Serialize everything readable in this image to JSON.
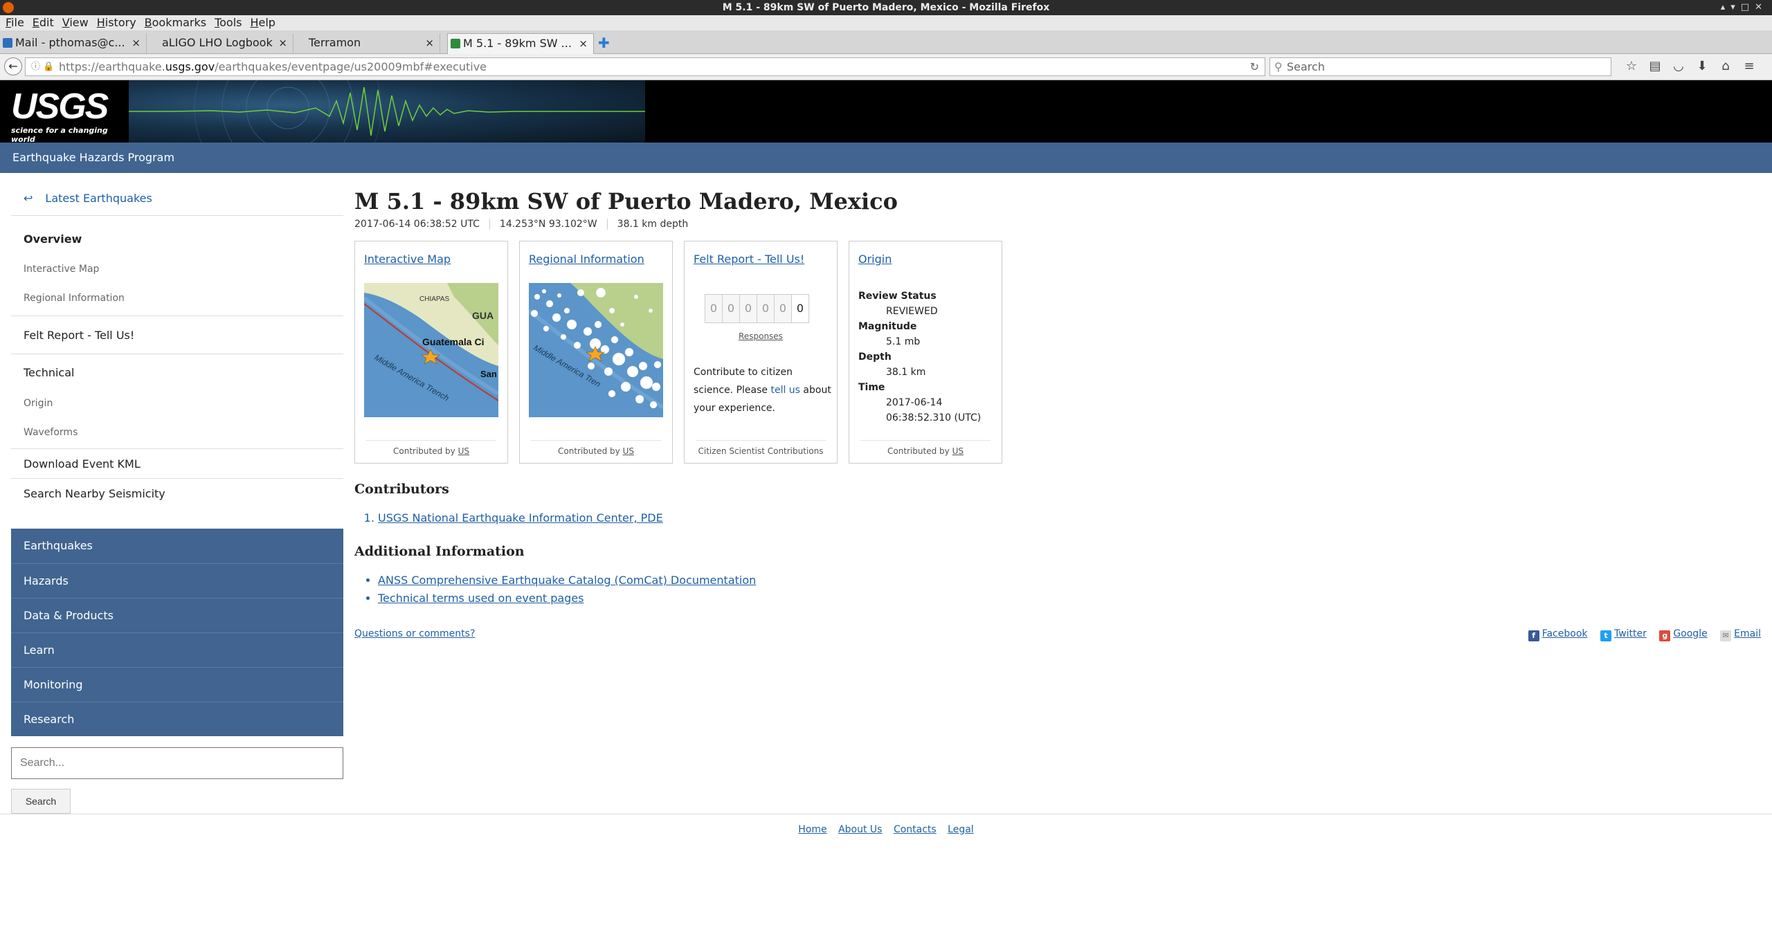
{
  "window": {
    "title": "M 5.1 - 89km SW of Puerto Madero, Mexico - Mozilla Firefox"
  },
  "menu": [
    "File",
    "Edit",
    "View",
    "History",
    "Bookmarks",
    "Tools",
    "Help"
  ],
  "tabs": [
    {
      "label": "Mail - pthomas@c...",
      "icon_color": "#2a6fbd"
    },
    {
      "label": "aLIGO LHO Logbook",
      "icon_color": ""
    },
    {
      "label": "Terramon",
      "icon_color": ""
    },
    {
      "label": "M 5.1 - 89km SW ...",
      "icon_color": "#2e8b3a"
    }
  ],
  "url": {
    "prefix": "https://earthquake.",
    "host": "usgs.gov",
    "path": "/earthquakes/eventpage/us20009mbf#executive"
  },
  "search_placeholder": "Search",
  "site": {
    "logo_text": "USGS",
    "logo_tagline": "science for a changing world",
    "program": "Earthquake Hazards Program"
  },
  "sidebar": {
    "latest": "Latest Earthquakes",
    "overview": "Overview",
    "interactive_map": "Interactive Map",
    "regional_info": "Regional Information",
    "felt_report": "Felt Report - Tell Us!",
    "technical": "Technical",
    "origin": "Origin",
    "waveforms": "Waveforms",
    "download_kml": "Download Event KML",
    "search_nearby": "Search Nearby Seismicity"
  },
  "site_nav": [
    "Earthquakes",
    "Hazards",
    "Data & Products",
    "Learn",
    "Monitoring",
    "Research"
  ],
  "site_search": {
    "placeholder": "Search...",
    "button": "Search"
  },
  "event": {
    "title": "M 5.1 - 89km SW of Puerto Madero, Mexico",
    "time": "2017-06-14 06:38:52 UTC",
    "coords": "14.253°N   93.102°W",
    "depth": "38.1 km depth"
  },
  "cards": {
    "map": {
      "title": "Interactive Map",
      "label_chiapas": "CHIAPAS",
      "label_gua": "GUA",
      "label_city": "Guatemala Ci",
      "label_trench": "Middle America Trench",
      "label_san": "San",
      "footer": "Contributed by",
      "contrib": "US"
    },
    "regional": {
      "title": "Regional Information",
      "label_trench": "Middle America Tren",
      "footer": "Contributed by",
      "contrib": "US"
    },
    "felt": {
      "title": "Felt Report - Tell Us!",
      "digits": [
        "0",
        "0",
        "0",
        "0",
        "0",
        "0"
      ],
      "responses": "Responses",
      "text_1": "Contribute to citizen science. Please",
      "text_link": "tell us",
      "text_2": "about your experience.",
      "footer": "Citizen Scientist Contributions"
    },
    "origin": {
      "title": "Origin",
      "review_label": "Review Status",
      "review_value": "REVIEWED",
      "mag_label": "Magnitude",
      "mag_value": "5.1 mb",
      "depth_label": "Depth",
      "depth_value": "38.1 km",
      "time_label": "Time",
      "time_date": "2017-06-14",
      "time_clock": "06:38:52.310 (UTC)",
      "footer": "Contributed by",
      "contrib": "US"
    }
  },
  "contributors": {
    "heading": "Contributors",
    "items": [
      "USGS National Earthquake Information Center, PDE"
    ]
  },
  "additional": {
    "heading": "Additional Information",
    "items": [
      "ANSS Comprehensive Earthquake Catalog (ComCat) Documentation",
      "Technical terms used on event pages"
    ]
  },
  "questions": "Questions or comments?",
  "share": [
    "Facebook",
    "Twitter",
    "Google",
    "Email"
  ],
  "footer": [
    "Home",
    "About Us",
    "Contacts",
    "Legal"
  ]
}
